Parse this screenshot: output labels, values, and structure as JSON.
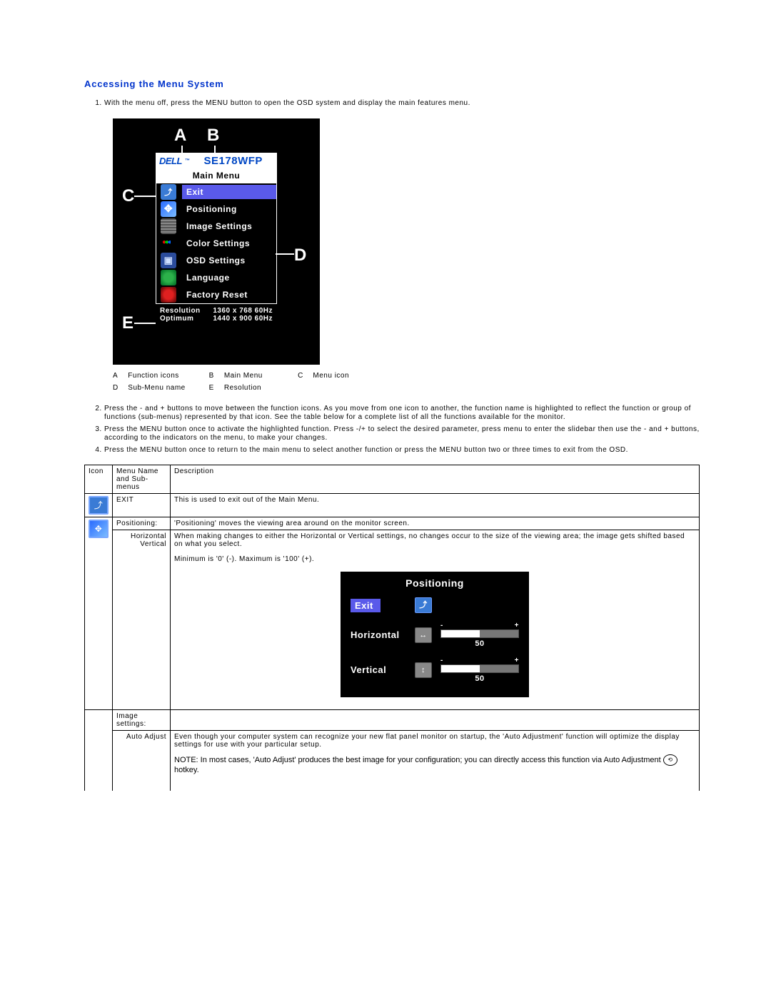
{
  "heading": "Accessing the Menu System",
  "steps_top": [
    "With the menu off, press the MENU button to open the OSD system and display the main features menu."
  ],
  "osd": {
    "brand": "DELL",
    "tm": "™",
    "model": "SE178WFP",
    "title": "Main Menu",
    "labels": {
      "A": "A",
      "B": "B",
      "C": "C",
      "D": "D",
      "E": "E"
    },
    "items": [
      {
        "label": "Exit"
      },
      {
        "label": "Positioning"
      },
      {
        "label": "Image Settings"
      },
      {
        "label": "Color Settings"
      },
      {
        "label": "OSD Settings"
      },
      {
        "label": "Language"
      },
      {
        "label": "Factory Reset"
      }
    ],
    "status": {
      "res_k": "Resolution",
      "res_v": "1360 x 768  60Hz",
      "opt_k": "Optimum",
      "opt_v": "1440 x 900  60Hz"
    }
  },
  "legend": {
    "A": "Function icons",
    "B": "Main Menu",
    "C": "Menu icon",
    "D": "Sub-Menu name",
    "E": "Resolution"
  },
  "steps_bottom": [
    "Press the - and + buttons to move between the function icons. As you move from one icon to another, the function name is highlighted to reflect the function or group of functions (sub-menus) represented by that icon. See the table below for a complete list of all the functions available for the monitor.",
    "Press the MENU button once to activate the highlighted function. Press -/+ to select the desired parameter, press menu to enter the slidebar then use the - and + buttons, according to the indicators on the menu, to make your changes.",
    "Press the MENU button once to return to the main menu to select another function or press the MENU button two or three times to exit from the OSD."
  ],
  "table": {
    "headers": {
      "icon": "Icon",
      "name": "Menu Name and Sub-menus",
      "desc": "Description"
    },
    "rows": {
      "exit": {
        "name": "EXIT",
        "desc": "This is used to exit out of the Main Menu."
      },
      "pos": {
        "name": "Positioning:",
        "sub_h": "Horizontal",
        "sub_v": "Vertical",
        "desc_main": "'Positioning' moves the viewing area around on the monitor screen.",
        "desc_sub": "When making changes to either the Horizontal or Vertical settings, no changes occur to the size of the viewing area; the image gets shifted based on what you select.",
        "desc_range": "Minimum is '0' (-). Maximum is '100' (+).",
        "sub_figure": {
          "title": "Positioning",
          "exit": "Exit",
          "horizontal": "Horizontal",
          "vertical": "Vertical",
          "value_h": "50",
          "value_v": "50"
        }
      },
      "img": {
        "name": "Image settings:",
        "sub_auto": "Auto Adjust",
        "desc": "Even though your computer system can recognize your new flat panel monitor on startup, the 'Auto Adjustment' function will optimize the display settings for use with your particular setup.",
        "note_pre": "NOTE: In most cases, 'Auto Adjust' produces the best image for your configuration; you can directly access this function via Auto Adjustment ",
        "note_post": " hotkey."
      }
    }
  }
}
